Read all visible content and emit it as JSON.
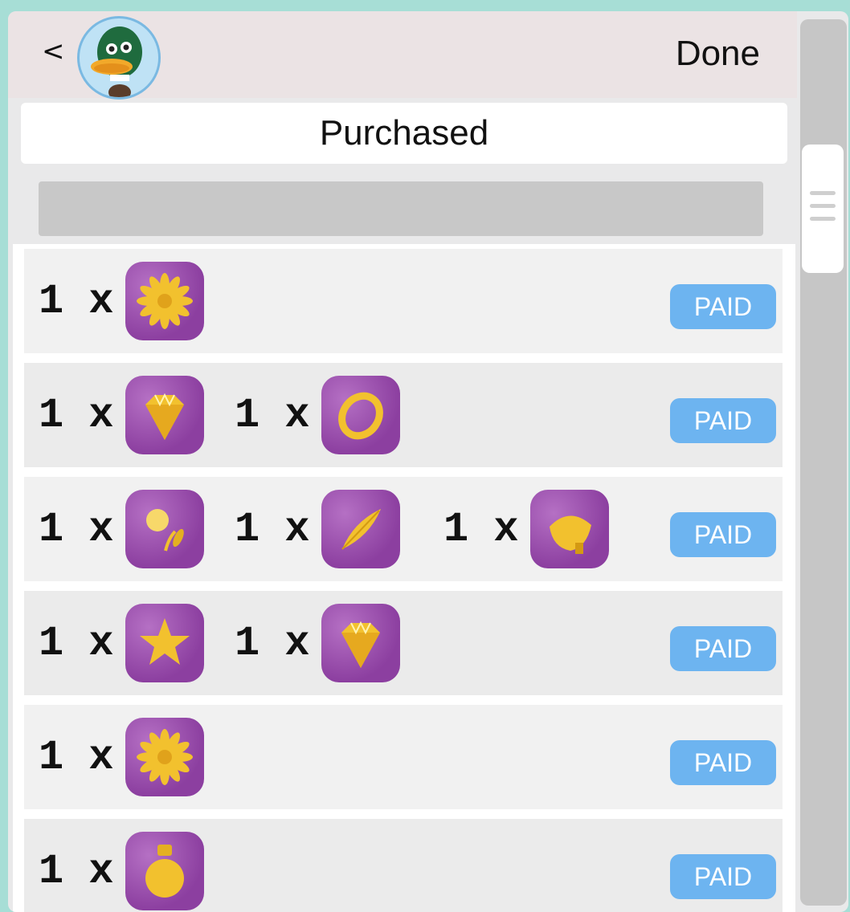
{
  "header": {
    "back_label": "<",
    "done_label": "Done"
  },
  "title": "Purchased",
  "colors": {
    "tile": "#9a4cad",
    "paid_badge": "#6db4f0",
    "gold": "#f2c12e"
  },
  "orders": [
    {
      "items": [
        {
          "qty": "1 x",
          "icon": "sunflower-icon"
        }
      ],
      "status": "PAID"
    },
    {
      "items": [
        {
          "qty": "1 x",
          "icon": "gem-icon"
        },
        {
          "qty": "1 x",
          "icon": "ring-icon"
        }
      ],
      "status": "PAID"
    },
    {
      "items": [
        {
          "qty": "1 x",
          "icon": "dandelion-icon"
        },
        {
          "qty": "1 x",
          "icon": "feather-icon"
        },
        {
          "qty": "1 x",
          "icon": "acorn-icon"
        }
      ],
      "status": "PAID"
    },
    {
      "items": [
        {
          "qty": "1 x",
          "icon": "star-icon"
        },
        {
          "qty": "1 x",
          "icon": "gem-icon"
        }
      ],
      "status": "PAID"
    },
    {
      "items": [
        {
          "qty": "1 x",
          "icon": "sunflower-icon"
        }
      ],
      "status": "PAID"
    },
    {
      "items": [
        {
          "qty": "1 x",
          "icon": "potion-icon"
        }
      ],
      "status": "PAID"
    }
  ]
}
